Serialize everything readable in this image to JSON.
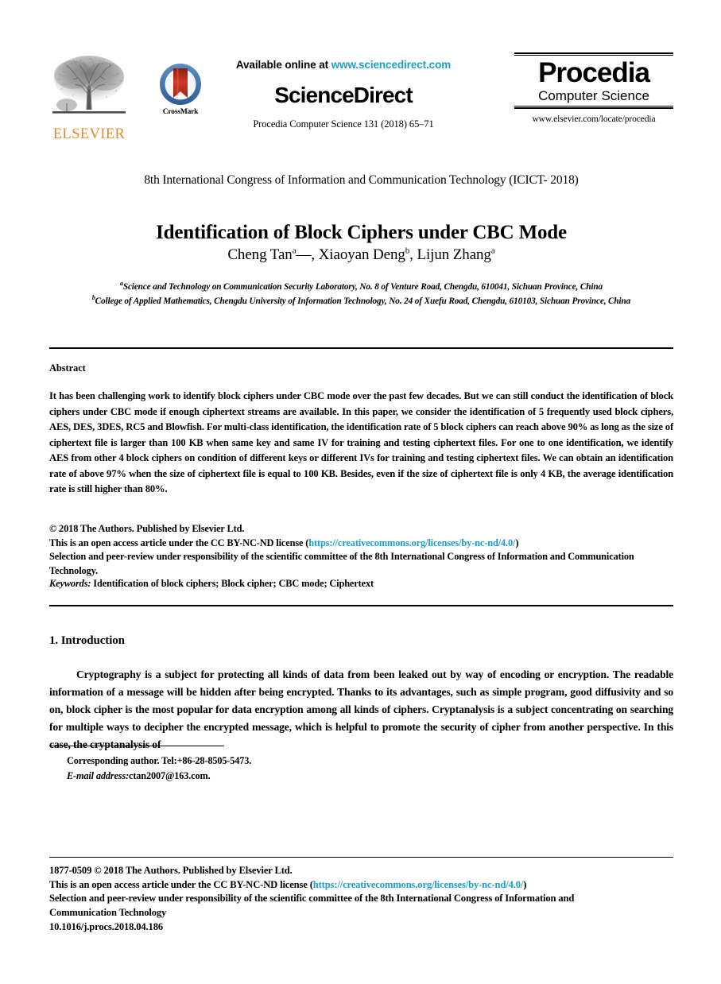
{
  "header": {
    "elsevier_logo_word": "ELSEVIER",
    "crossmark_label": "CrossMark",
    "available_prefix": "Available online at ",
    "available_url": "www.sciencedirect.com",
    "sciencedirect_wordmark": "ScienceDirect",
    "journal_citation": "Procedia Computer Science 131 (2018) 65–71",
    "procedia_title": "Procedia",
    "procedia_subtitle": "Computer Science",
    "procedia_url": "www.elsevier.com/locate/procedia"
  },
  "title_block": {
    "conference": "8th International Congress of Information and Communication Technology (ICICT- 2018)",
    "paper_title": "Identification of Block Ciphers under CBC Mode",
    "authors_html": "Cheng Tan<sup>a</sup>—, Xiaoyan Deng<sup>b</sup>, Lijun Zhang<sup>a</sup>",
    "affiliation_a_marker": "a",
    "affiliation_a": "Science and Technology on Communication Security Laboratory, No. 8 of Venture Road,  Chengdu, 610041, Sichuan Province, China",
    "affiliation_b_marker": "b",
    "affiliation_b": "College of Applied Mathematics, Chengdu University of Information Technology, No. 24 of Xuefu Road, Chengdu, 610103, Sichuan Province, China"
  },
  "abstract": {
    "heading": "Abstract",
    "text": "It has been challenging work to identify block ciphers under CBC mode over the past few decades. But we can still conduct the identification of block ciphers under CBC mode if enough ciphertext streams are available. In this paper, we consider the identification of 5 frequently used block ciphers, AES, DES, 3DES, RC5 and Blowfish. For multi-class identification, the identification rate of 5 block ciphers can reach above 90% as long as the size of ciphertext file is larger than 100 KB when same key and same IV for training and testing ciphertext files. For one to one identification, we identify AES from other 4 block ciphers on condition of different keys or different IVs for training and testing ciphertext files. We can obtain an identification rate of above 97% when the size of ciphertext file is equal to 100 KB. Besides, even if the size of ciphertext file is only 4 KB, the average identification rate is still higher than 80%."
  },
  "license": {
    "copyright": "© 2018 The Authors. Published by Elsevier Ltd.",
    "open_access_prefix": "This is an open access article under the CC BY-NC-ND license (",
    "open_access_url": "https://creativecommons.org/licenses/by-nc-nd/4.0/",
    "open_access_suffix": ")",
    "selection": "Selection and peer-review under responsibility of the scientific committee of the 8th International Congress of Information and Communication Technology."
  },
  "keywords": {
    "label": "Keywords:",
    "value": " Identification of block ciphers; Block cipher; CBC mode; Ciphertext"
  },
  "body": {
    "section_heading": "1. Introduction",
    "paragraph": "Cryptography is a subject for protecting all kinds of data from been leaked out by way of encoding or encryption. The readable information of a message will be hidden after being encrypted. Thanks to its advantages, such as simple program, good diffusivity and so on, block cipher is the most popular for data encryption among all kinds of ciphers. Cryptanalysis is a subject concentrating on searching for multiple ways to decipher the encrypted message, which is helpful to promote the security of cipher from another perspective. In this case, the cryptanalysis of"
  },
  "footnote": {
    "corresponding": "Corresponding author. Tel:+86-28-8505-5473.",
    "email_label": "E-mail address:",
    "email_value": "ctan2007@163.com."
  },
  "footer": {
    "line1": "1877-0509 © 2018 The Authors. Published by Elsevier Ltd.",
    "line2_prefix": "This is an open access article under the CC BY-NC-ND license (",
    "line2_url": "https://creativecommons.org/licenses/by-nc-nd/4.0/",
    "line2_suffix": ")",
    "line3": "Selection and peer-review under responsibility of the scientific committee of the 8th International Congress of Information and",
    "line4": "Communication Technology",
    "doi": "10.1016/j.procs.2018.04.186"
  },
  "colors": {
    "elsevier_orange": "#E8892B",
    "link_blue": "#1a9ec9",
    "crossmark_ring": "#3c6ea5",
    "crossmark_ribbon": "#b32317"
  }
}
